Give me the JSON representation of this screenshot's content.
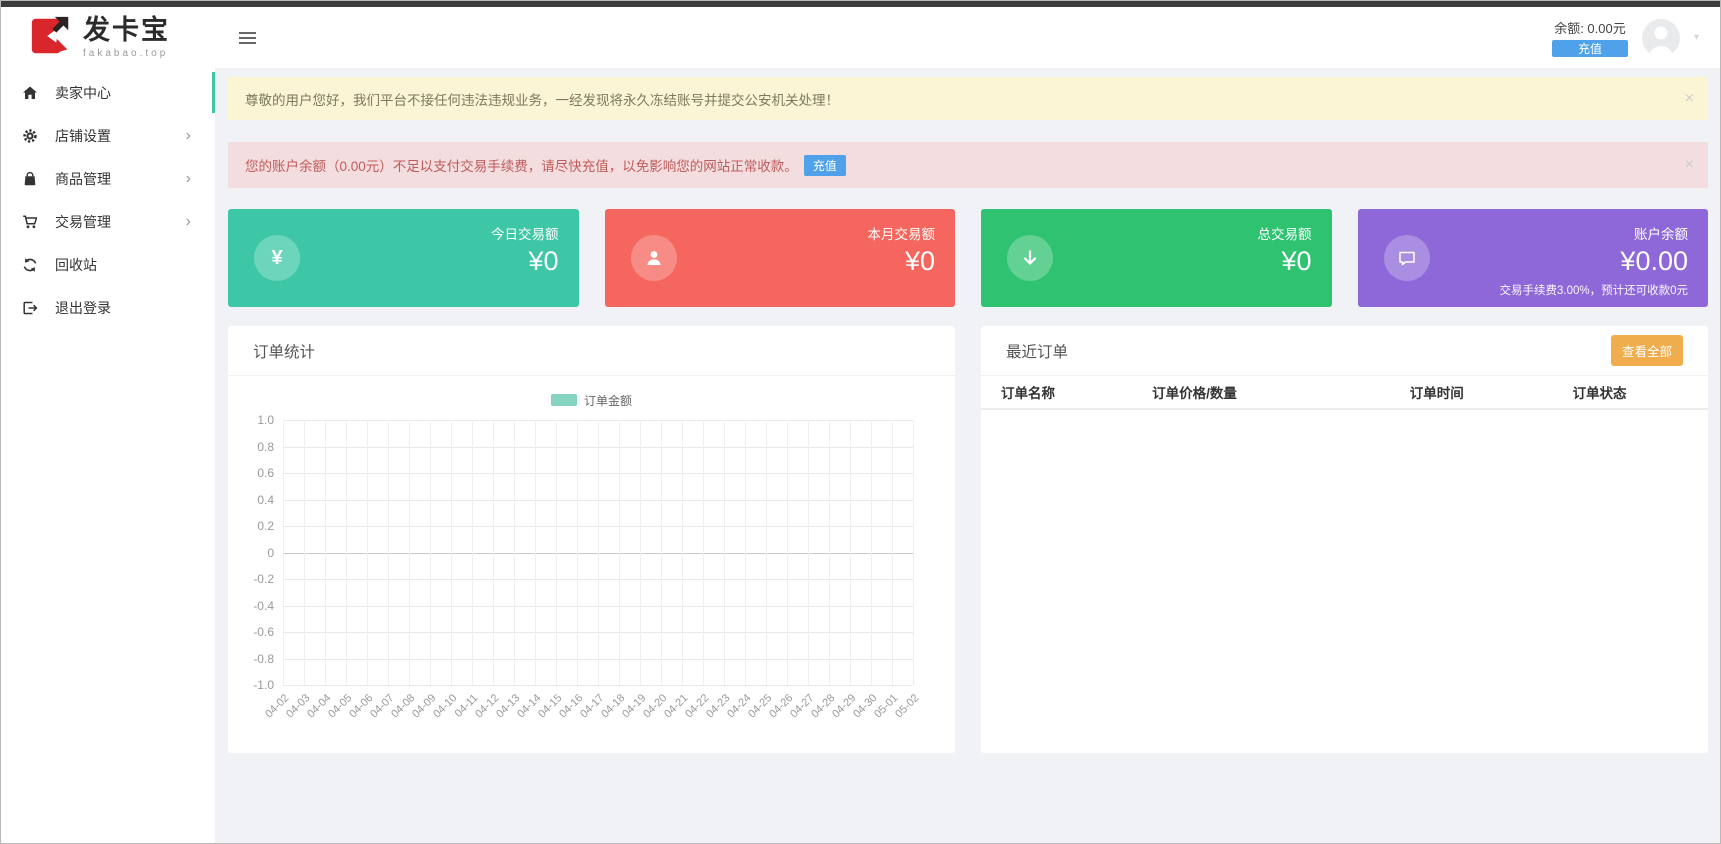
{
  "brand": {
    "name": "发卡宝",
    "domain": "fakabao.top"
  },
  "topbar": {
    "balance_label": "余额: 0.00元",
    "recharge_label": "充值"
  },
  "sidebar": {
    "items": [
      {
        "id": "seller-center",
        "label": "卖家中心",
        "icon": "home-icon",
        "active": true,
        "has_children": false
      },
      {
        "id": "shop-settings",
        "label": "店铺设置",
        "icon": "gear-icon",
        "active": false,
        "has_children": true
      },
      {
        "id": "product-management",
        "label": "商品管理",
        "icon": "bag-icon",
        "active": false,
        "has_children": true
      },
      {
        "id": "trade-management",
        "label": "交易管理",
        "icon": "cart-icon",
        "active": false,
        "has_children": true
      },
      {
        "id": "recycle-bin",
        "label": "回收站",
        "icon": "recycle-icon",
        "active": false,
        "has_children": false
      },
      {
        "id": "logout",
        "label": "退出登录",
        "icon": "logout-icon",
        "active": false,
        "has_children": false
      }
    ]
  },
  "alerts": [
    {
      "type": "warning",
      "text": "尊敬的用户您好，我们平台不接任何违法违规业务，一经发现将永久冻结账号并提交公安机关处理！",
      "close_label": "×"
    },
    {
      "type": "danger",
      "text": "您的账户余额（0.00元）不足以支付交易手续费，请尽快充值，以免影响您的网站正常收款。",
      "button_label": "充值",
      "close_label": "×"
    }
  ],
  "stat_cards": [
    {
      "id": "today-trade",
      "label": "今日交易额",
      "value": "¥0",
      "color": "#3dc7a6",
      "icon": "yen-icon"
    },
    {
      "id": "month-trade",
      "label": "本月交易额",
      "value": "¥0",
      "color": "#f4665e",
      "icon": "person-icon"
    },
    {
      "id": "total-trade",
      "label": "总交易额",
      "value": "¥0",
      "color": "#2fc271",
      "icon": "arrow-down-icon"
    },
    {
      "id": "account-balance",
      "label": "账户余额",
      "value": "¥0.00",
      "color": "#8e68d8",
      "icon": "chat-icon",
      "note": "交易手续费3.00%，预计还可收款0元"
    }
  ],
  "order_stats": {
    "title": "订单统计"
  },
  "chart_data": {
    "type": "line",
    "title": "订单统计",
    "series": [
      {
        "name": "订单金额",
        "values": []
      }
    ],
    "x": [
      "04-02",
      "04-03",
      "04-04",
      "04-05",
      "04-06",
      "04-07",
      "04-08",
      "04-09",
      "04-10",
      "04-11",
      "04-12",
      "04-13",
      "04-14",
      "04-15",
      "04-16",
      "04-17",
      "04-18",
      "04-19",
      "04-20",
      "04-21",
      "04-22",
      "04-23",
      "04-24",
      "04-25",
      "04-26",
      "04-27",
      "04-28",
      "04-29",
      "04-30",
      "05-01",
      "05-02"
    ],
    "y_tick_labels": [
      "1.0",
      "0.8",
      "0.6",
      "0.4",
      "0.2",
      "0",
      "-0.2",
      "-0.4",
      "-0.6",
      "-0.8",
      "-1.0"
    ],
    "ylim": [
      -1,
      1
    ],
    "grid": true,
    "legend_position": "top-center",
    "legend_color": "#85d4c1"
  },
  "recent_orders": {
    "title": "最近订单",
    "view_all_label": "查看全部",
    "columns": [
      "订单名称",
      "订单价格/数量",
      "订单时间",
      "订单状态"
    ],
    "rows": []
  }
}
